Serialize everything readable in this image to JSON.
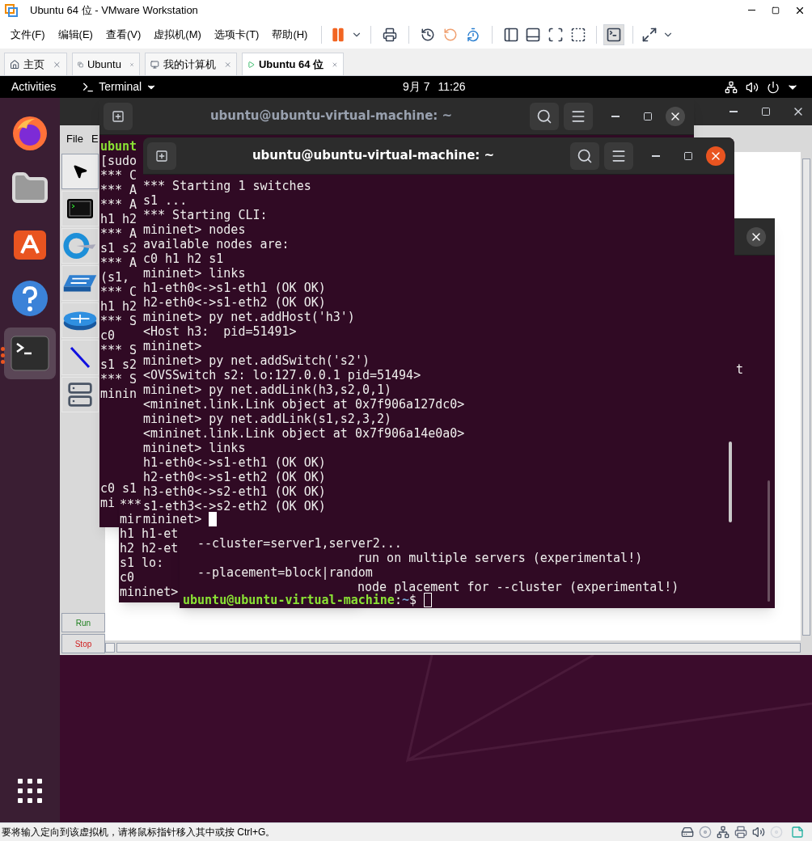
{
  "window": {
    "title": "Ubuntu 64 位 - VMware Workstation"
  },
  "menu": [
    "文件(F)",
    "编辑(E)",
    "查看(V)",
    "虚拟机(M)",
    "选项卡(T)",
    "帮助(H)"
  ],
  "tabs": [
    {
      "kind": "home",
      "label": "主页",
      "selected": false
    },
    {
      "kind": "vm",
      "label": "Ubuntu",
      "selected": false
    },
    {
      "kind": "computer",
      "label": "我的计算机",
      "selected": false
    },
    {
      "kind": "running_vm",
      "label": "Ubuntu 64 位",
      "selected": true
    }
  ],
  "top_bar": {
    "activities": "Activities",
    "app": "Terminal",
    "date": "9月 7",
    "time": "11:26"
  },
  "dock": [
    {
      "kind": "browser",
      "selected": false,
      "running": false
    },
    {
      "kind": "files",
      "selected": false,
      "running": false
    },
    {
      "kind": "store",
      "selected": false,
      "running": false
    },
    {
      "kind": "help",
      "selected": false,
      "running": false
    },
    {
      "kind": "terminal",
      "selected": true,
      "running": true
    }
  ],
  "miniedit": {
    "menus": [
      "File",
      "E"
    ],
    "tools": [
      {
        "kind": "select",
        "selected": true
      },
      {
        "kind": "host",
        "selected": false
      },
      {
        "kind": "controller",
        "selected": false
      },
      {
        "kind": "switch",
        "selected": false
      },
      {
        "kind": "router",
        "selected": false
      },
      {
        "kind": "link",
        "selected": false
      },
      {
        "kind": "server",
        "selected": false
      }
    ],
    "buttons": [
      {
        "kind": "run",
        "label": "Run"
      },
      {
        "kind": "stop",
        "label": "Stop"
      }
    ]
  },
  "terminal_middle": {
    "title": "ubuntu@ubuntu-virtual-machine: ~",
    "focused": false,
    "lines": [
      {
        "kind": "prompt_fragment",
        "text": "ubunt"
      },
      "[sudo",
      "*** C",
      "*** A",
      "*** A",
      "h1 h2",
      "*** A",
      "s1 s2",
      "*** A",
      "(s1, ",
      "*** C",
      "h1 h2",
      "*** S",
      "c0",
      "*** S",
      "s1 s2",
      "*** S",
      "minin"
    ],
    "bottom_lines": [
      "c0 s1",
      "mi"
    ]
  },
  "terminal_small": {
    "lines": [
      "***",
      "mir",
      "h1 h1-et",
      "h2 h2-et",
      "s1 lo:",
      "c0",
      "mininet>"
    ]
  },
  "terminal_back": {
    "focused": false,
    "fragment": "t",
    "lines": [
      {
        "kind": "option",
        "text": "--cluster=server1,server2..."
      },
      {
        "kind": "description",
        "text": "run on multiple servers (experimental!)"
      },
      {
        "kind": "option",
        "text": "--placement=block|random"
      },
      {
        "kind": "description",
        "text": "node placement for --cluster (experimental!)"
      },
      {
        "kind": "prompt",
        "user_host": "ubuntu@ubuntu-virtual-machine",
        "sep": ":",
        "path": "~",
        "symbol": "$"
      }
    ]
  },
  "terminal_front": {
    "title": "ubuntu@ubuntu-virtual-machine: ~",
    "focused": true,
    "lines": [
      "*** Starting 1 switches",
      "s1 ...",
      "*** Starting CLI:",
      "mininet> nodes",
      "available nodes are:",
      "c0 h1 h2 s1",
      "mininet> links",
      "h1-eth0<->s1-eth1 (OK OK)",
      "h2-eth0<->s1-eth2 (OK OK)",
      "mininet> py net.addHost('h3')",
      "<Host h3:  pid=51491>",
      "mininet>",
      "mininet> py net.addSwitch('s2')",
      "<OVSSwitch s2: lo:127.0.0.1 pid=51494>",
      "mininet> py net.addLink(h3,s2,0,1)",
      "<mininet.link.Link object at 0x7f906a127dc0>",
      "mininet> py net.addLink(s1,s2,3,2)",
      "<mininet.link.Link object at 0x7f906a14e0a0>",
      "mininet> links",
      "h1-eth0<->s1-eth1 (OK OK)",
      "h2-eth0<->s1-eth2 (OK OK)",
      "h3-eth0<->s2-eth1 (OK OK)",
      "s1-eth3<->s2-eth2 (OK OK)",
      {
        "kind": "input",
        "text": "mininet>"
      }
    ]
  },
  "status_bar": {
    "text": "要将输入定向到该虚拟机，请将鼠标指针移入其中或按 Ctrl+G。"
  }
}
